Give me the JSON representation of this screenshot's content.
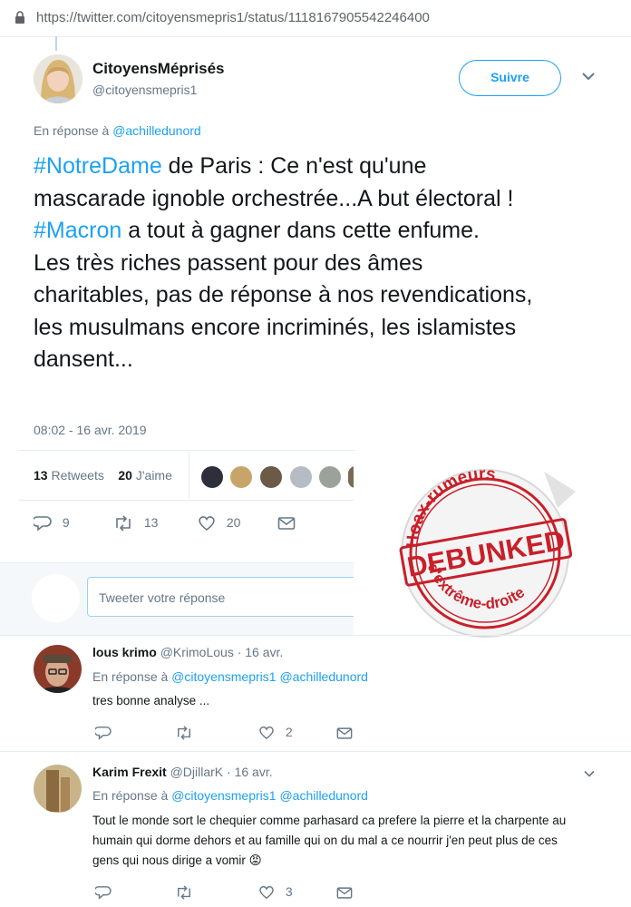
{
  "browser": {
    "url": "https://twitter.com/citoyensmepris1/status/1118167905542246400"
  },
  "tweet": {
    "display_name": "CitoyensMéprisés",
    "handle": "@citoyensmepris1",
    "follow_label": "Suivre",
    "reply_prefix": "En réponse à",
    "reply_mention": "@achilledunord",
    "text": {
      "hashtag1": "#NotreDame",
      "part1": " de Paris : Ce n'est qu'une mascarade ignoble orchestrée...A but électoral ! ",
      "hashtag2": "#Macron",
      "part2": " a tout à gagner dans cette enfume.",
      "part3": "Les très riches passent pour des âmes charitables, pas de réponse à nos revendications, les musulmans encore incriminés, les islamistes dansent..."
    },
    "timestamp": "08:02 - 16 avr. 2019",
    "retweets_count": "13",
    "retweets_label": "Retweets",
    "likes_count": "20",
    "likes_label": "J'aime",
    "actions": {
      "replies": "9",
      "retweets": "13",
      "likes": "20"
    }
  },
  "reply_box": {
    "placeholder": "Tweeter votre réponse"
  },
  "stamp": {
    "top_text": "Hoax-rumeurs",
    "main_text": "DEBUNKED",
    "bottom_text": "d'extrême-droite",
    "color": "#c8202a"
  },
  "replies": [
    {
      "name": "lous krimo",
      "handle_date": "@KrimoLous · 16 avr.",
      "reply_prefix": "En réponse à",
      "mentions": "@citoyensmepris1 @achilledunord",
      "text": "tres bonne analyse ...",
      "actions": {
        "likes": "2"
      }
    },
    {
      "name": "Karim Frexit",
      "handle_date": "@DjillarK · 16 avr.",
      "reply_prefix": "En réponse à",
      "mentions": "@citoyensmepris1 @achilledunord",
      "text": "Tout le monde sort le chequier comme parhasard ca prefere la pierre et la charpente au humain qui dorme dehors et au famille qui on du mal a ce nourrir j'en peut plus de ces gens qui nous dirige a vomir",
      "emoji": "😡",
      "actions": {
        "likes": "3"
      }
    }
  ],
  "colors": {
    "accent": "#1da1f2",
    "muted": "#657786",
    "text": "#14171a",
    "divider": "#e6ecf0"
  }
}
